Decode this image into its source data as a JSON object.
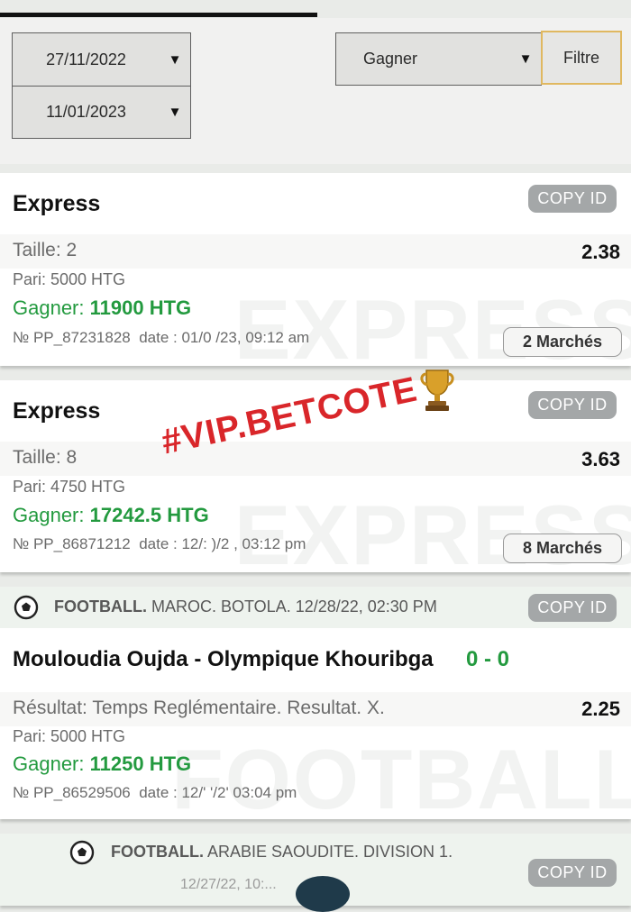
{
  "filters": {
    "date_from": "27/11/2022",
    "date_to": "11/01/2023",
    "status": "Gagner",
    "filter_label": "Filtre",
    "arrow": "▼"
  },
  "overlay": {
    "watermark_text": "#VIP.BETCOTE"
  },
  "cards": [
    {
      "title": "Express",
      "copy_label": "COPY ID",
      "size_label": "Taille: 2",
      "odds": "2.38",
      "stake": "Pari: 5000 HTG",
      "win_label": "Gagner:",
      "win_amount": "11900 HTG",
      "ref_no": "№ PP_87231828",
      "date": "date : 01/0  /23, 09:12 am",
      "markets": "2 Marchés",
      "watermark": "EXPRESS"
    },
    {
      "title": "Express",
      "copy_label": "COPY ID",
      "size_label": "Taille: 8",
      "odds": "3.63",
      "stake": "Pari: 4750 HTG",
      "win_label": "Gagner:",
      "win_amount": "17242.5 HTG",
      "ref_no": "№ PP_86871212",
      "date": "date : 12/: )/2 , 03:12 pm",
      "markets": "8 Marchés",
      "watermark": "EXPRESS"
    },
    {
      "sport": "FOOTBALL.",
      "league": "MAROC. BOTOLA. 12/28/22, 02:30 PM",
      "copy_label": "COPY ID",
      "match": "Mouloudia Oujda - Olympique Khouribga",
      "score": "0 - 0",
      "result_label": "Résultat: Temps Reglémentaire. Resultat. X.",
      "odds": "2.25",
      "stake": "Pari: 5000 HTG",
      "win_label": "Gagner:",
      "win_amount": "11250 HTG",
      "ref_no": "№ PP_86529506",
      "date": "date : 12/' '/2' 03:04 pm",
      "watermark": "FOOTBALL"
    },
    {
      "sport": "FOOTBALL.",
      "league": "ARABIE SAOUDITE. DIVISION 1.",
      "copy_label": "COPY ID",
      "date_partial": "12/27/22, 10:..."
    }
  ]
}
